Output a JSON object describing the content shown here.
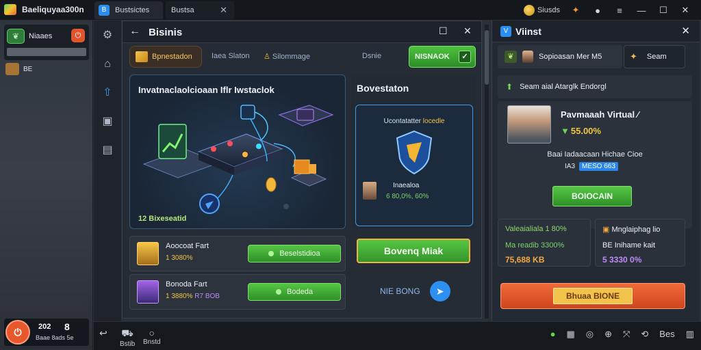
{
  "titlebar": {
    "app_title": "Baeliquyaa300n",
    "tabs": [
      {
        "label": "Bustsictes",
        "icon": "app-icon"
      },
      {
        "label": "Bustsa"
      }
    ],
    "coins_label": "Siusds",
    "window_controls": [
      "minimize",
      "maximize",
      "close"
    ]
  },
  "leftside": {
    "card_label": "Niaaes",
    "item2_label": "BE",
    "bottom": {
      "count": "202",
      "value": "8",
      "sub": "Baae 8ads 5e"
    }
  },
  "main": {
    "title": "Bisinis",
    "subtabs": {
      "active": "Bpnestadon",
      "tab2": "Iaea Slaton",
      "tab3": "Silommage",
      "tab4": "Dsnie",
      "green_button": "NISNAOK"
    },
    "feature": {
      "title": "Invatnaclaolcioaan Iflr Iwstaclok",
      "caption": "12 Bixeseatid"
    },
    "side_card": {
      "title": "Bovestaton",
      "inner_text": "Ucontatatter",
      "inner_highlight": "locedle",
      "person_label": "Inaealoa",
      "person_value": "6 80,0%, 60%"
    },
    "rows": [
      {
        "name": "Aoocoat Fart",
        "value": "1 3080%",
        "button": "Beselstidioa"
      },
      {
        "name": "Bonoda Fart",
        "value": "1 3880%",
        "value2": "R7 BOB",
        "button": "Bodeda"
      }
    ],
    "big_button": "Bovenq Miak",
    "link_text": "NIE BONG"
  },
  "right": {
    "title": "Viinst",
    "tab1": "Sopioasan Mer M5",
    "tab2": "Seam",
    "section": "Seam aial Atarglk Endorgl",
    "person": {
      "name": "Pavmaaah Virtual",
      "pct": "55.00%",
      "desc": "Baai Iadaacaan Hichae Cioe",
      "desc2": "IA3",
      "tag": "MESO 663",
      "button": "BOIOCAIN"
    },
    "box1": {
      "title": "Valeaialiala 1 80%",
      "mid": "Ma readib 3300%",
      "value": "75,688 KB"
    },
    "box2": {
      "title": "Mnglaiphag lio",
      "mid": "BE Inihame kait",
      "value": "5 3330 0%"
    },
    "orange_button": "Bhuaa BIONE"
  },
  "taskbar": {
    "left": [
      "Back",
      "Bstib",
      "Bnstd"
    ],
    "right_count": "Bes"
  },
  "colors": {
    "accent_green": "#4ec13f",
    "accent_blue": "#2a8df0",
    "accent_orange": "#e0552e",
    "gold": "#f2c645"
  }
}
